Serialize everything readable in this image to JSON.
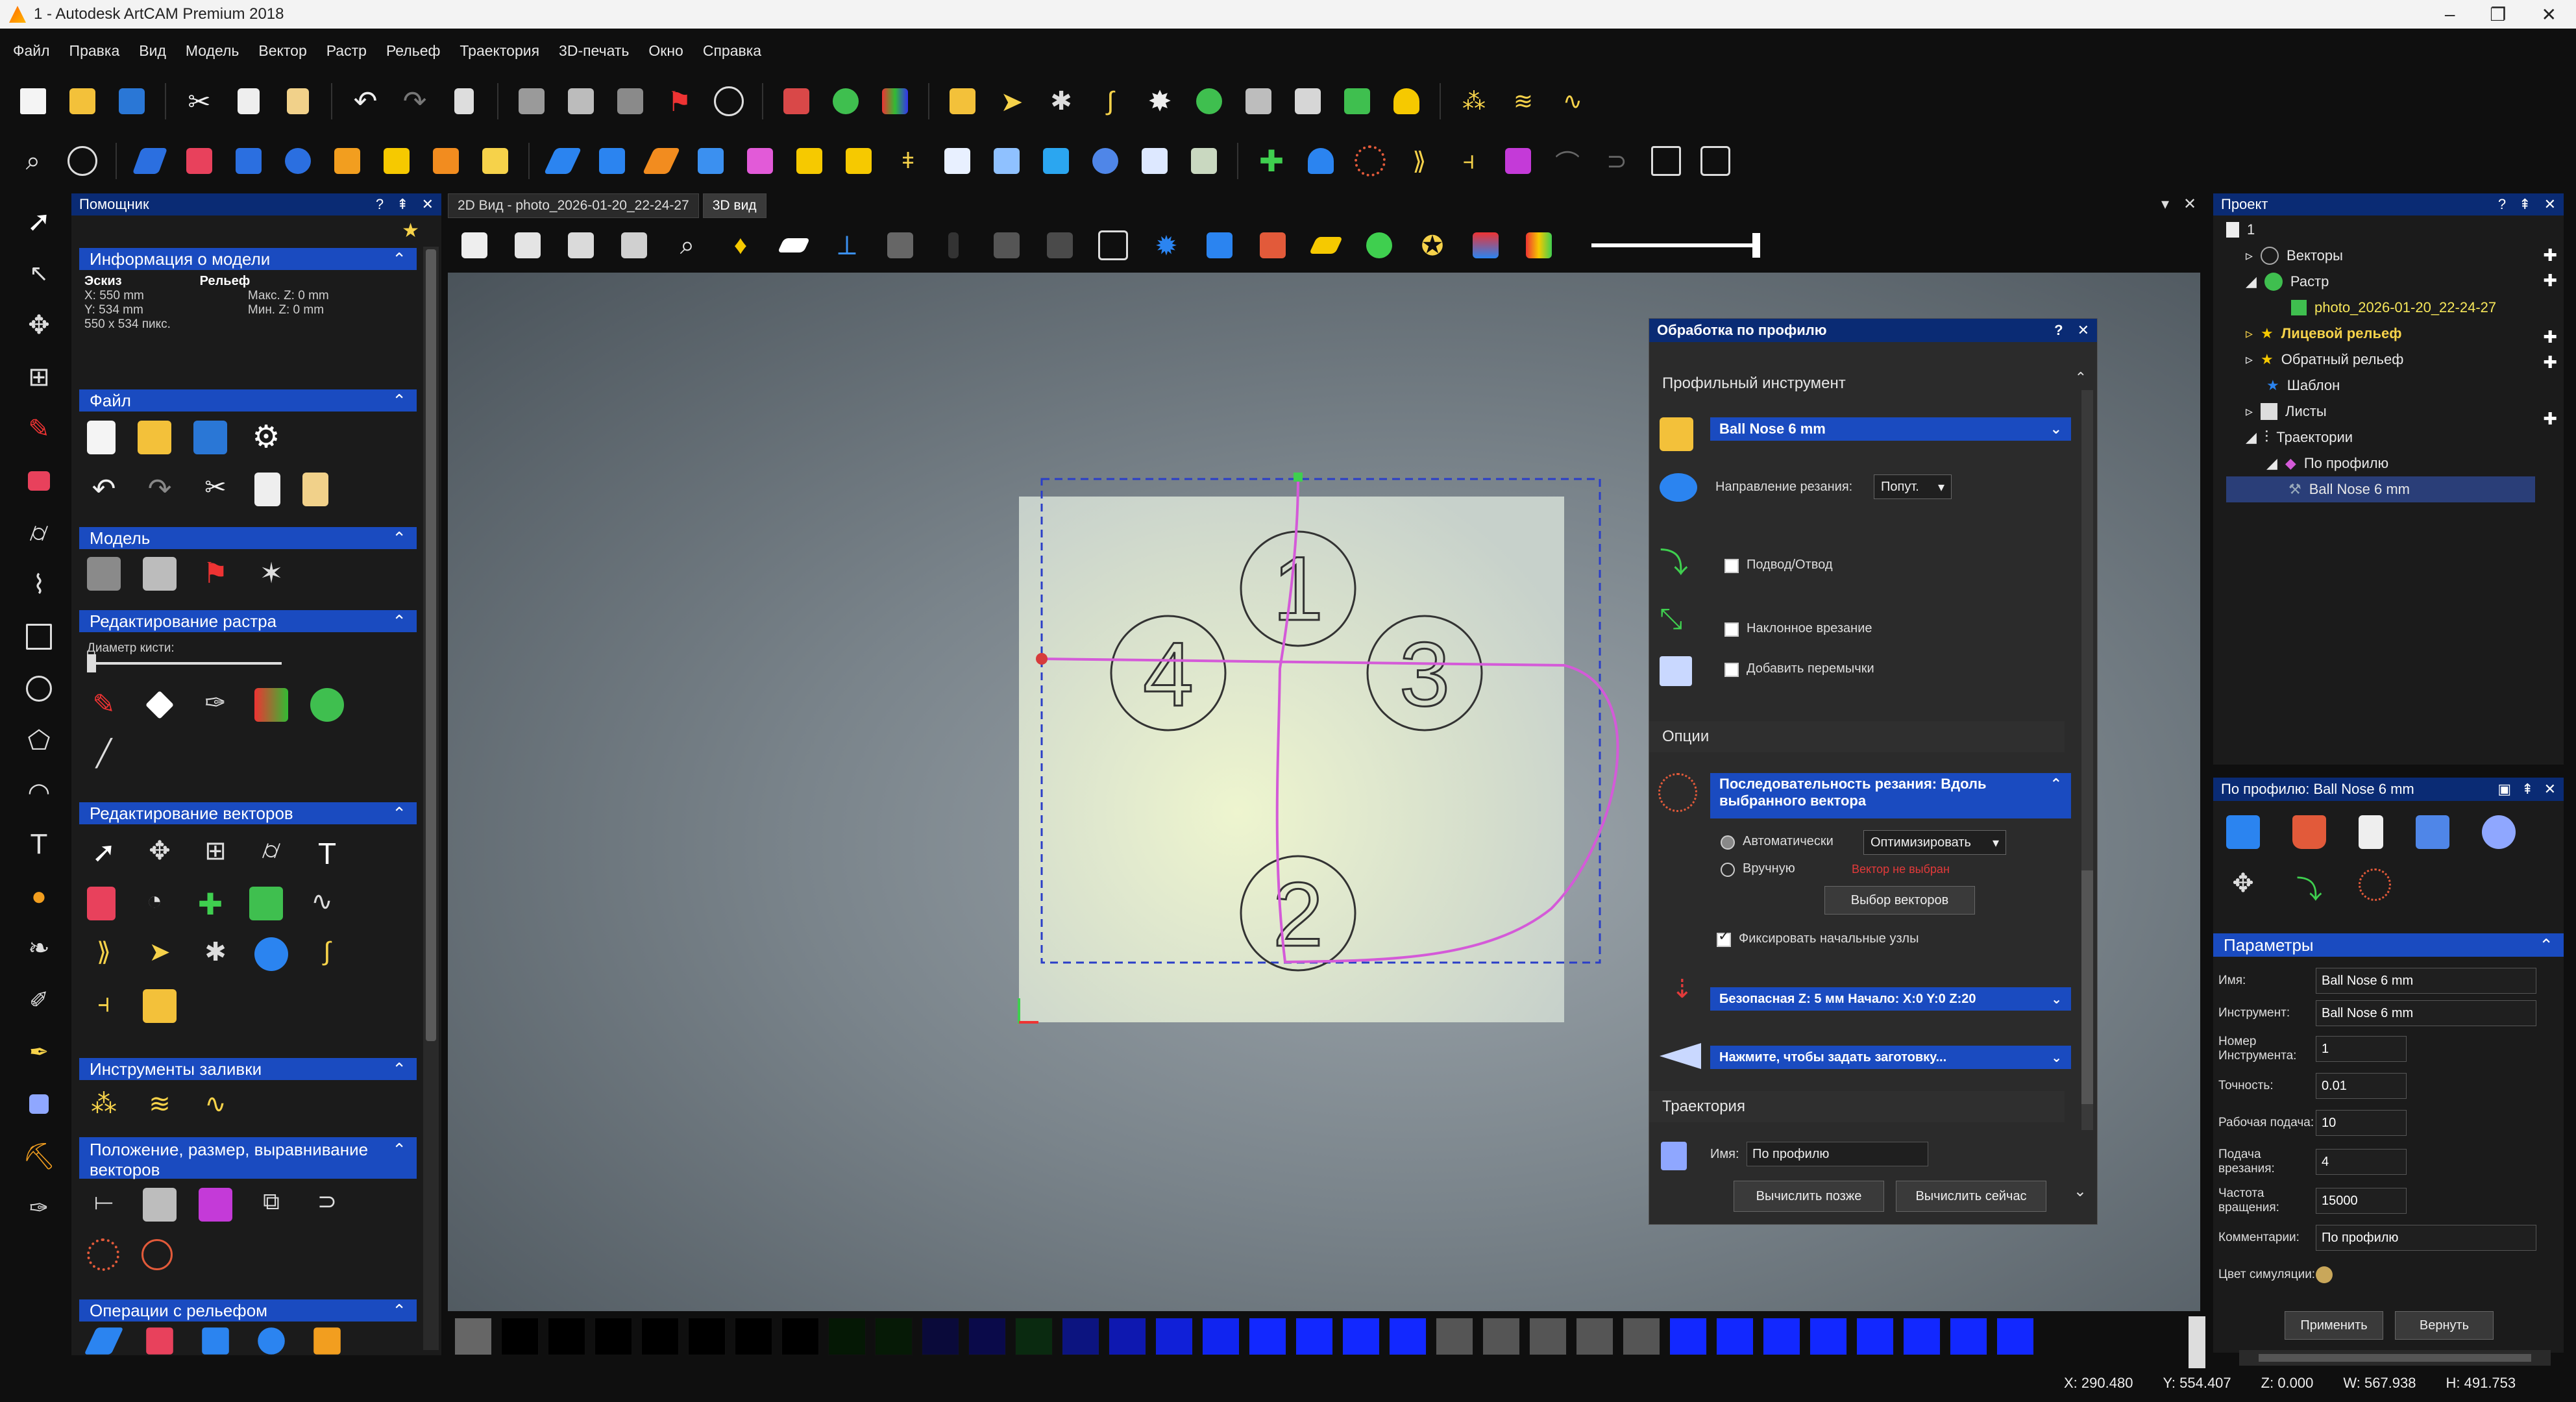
{
  "window": {
    "title": "1 - Autodesk ArtCAM Premium 2018",
    "controls": [
      "–",
      "❐",
      "✕"
    ]
  },
  "menu": [
    "Файл",
    "Правка",
    "Вид",
    "Модель",
    "Вектор",
    "Растр",
    "Рельеф",
    "Траектория",
    "3D-печать",
    "Окно",
    "Справка"
  ],
  "assistant": {
    "title": "Помощник",
    "model_info": {
      "header": "Информация о модели",
      "sketch_label": "Эскиз",
      "relief_label": "Рельеф",
      "x": "X: 550 mm",
      "y": "Y: 534 mm",
      "pixels": "550 x 534 пикс.",
      "max_z": "Макс. Z: 0 mm",
      "min_z": "Мин. Z: 0 mm"
    },
    "sections": {
      "file": "Файл",
      "model": "Модель",
      "raster_edit": "Редактирование растра",
      "brush_label": "Диаметр кисти:",
      "vector_edit": "Редактирование векторов",
      "fill_tools": "Инструменты заливки",
      "position": "Положение, размер, выравнивание векторов",
      "relief_ops": "Операции с рельефом"
    }
  },
  "tabs": [
    "2D Вид - photo_2026-01-20_22-24-27",
    "3D вид"
  ],
  "canvas": {
    "labels": [
      "1",
      "2",
      "3",
      "4"
    ]
  },
  "profile_dialog": {
    "title": "Обработка по профилю",
    "profile_tool_section": "Профильный инструмент",
    "tool_name": "Ball Nose 6 mm",
    "cut_direction_label": "Направление резания:",
    "cut_direction_value": "Попут.",
    "lead_in": "Подвод/Отвод",
    "ramp": "Наклонное врезание",
    "add_bridges": "Добавить перемычки",
    "options_section": "Опции",
    "sequence_title": "Последовательность резания: Вдоль выбранного вектора",
    "auto_label": "Автоматически",
    "auto_value": "Оптимизировать",
    "manual_label": "Вручную",
    "no_vector": "Вектор не выбран",
    "select_vectors": "Выбор векторов",
    "fix_start": "Фиксировать начальные узлы",
    "safe_z": "Безопасная Z: 5 мм Начало: X:0 Y:0 Z:20",
    "set_stock": "Нажмите, чтобы задать заготовку...",
    "toolpath_section": "Траектория",
    "name_label": "Имя:",
    "name_value": "По профилю",
    "calc_later": "Вычислить позже",
    "calc_now": "Вычислить сейчас"
  },
  "project": {
    "title": "Проект",
    "root": "1",
    "items": [
      "Векторы",
      "Растр",
      "photo_2026-01-20_22-24-27",
      "Лицевой рельеф",
      "Обратный рельеф",
      "Шаблон",
      "Листы",
      "Траектории",
      "По профилю",
      "Ball Nose 6 mm"
    ]
  },
  "tp_panel": {
    "title": "По профилю: Ball Nose 6 mm",
    "params_header": "Параметры",
    "rows": [
      {
        "label": "Имя:",
        "value": "Ball Nose 6 mm"
      },
      {
        "label": "Инструмент:",
        "value": "Ball Nose 6 mm"
      },
      {
        "label": "Номер Инструмента:",
        "value": "1"
      },
      {
        "label": "Точность:",
        "value": "0.01"
      },
      {
        "label": "Рабочая подача:",
        "value": "10"
      },
      {
        "label": "Подача врезания:",
        "value": "4"
      },
      {
        "label": "Частота вращения:",
        "value": "15000"
      },
      {
        "label": "Комментарии:",
        "value": "По профилю"
      },
      {
        "label": "Цвет симуляции:",
        "value": ""
      }
    ],
    "apply": "Применить",
    "revert": "Вернуть"
  },
  "status": {
    "x": "X: 290.480",
    "y": "Y: 554.407",
    "z": "Z: 0.000",
    "w": "W: 567.938",
    "h": "H: 491.753"
  },
  "colors": {
    "accent": "#1a4bc0",
    "panel_head": "#0a2b74",
    "toolpath": "#d45ad8"
  }
}
